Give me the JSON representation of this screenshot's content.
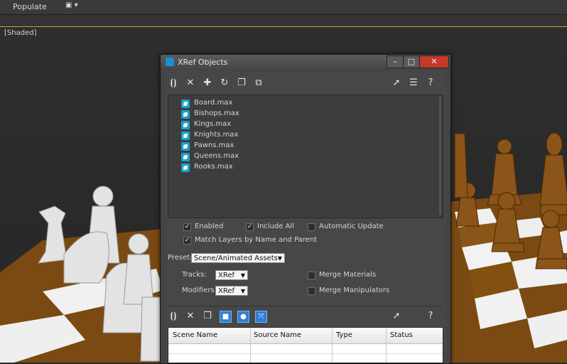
{
  "ribbon": {
    "populate_label": "Populate",
    "dropdown_glyph": "▣ ▾"
  },
  "viewport": {
    "label": "[Shaded]"
  },
  "dialog": {
    "title": "XRef Objects",
    "title_controls": {
      "minimize": "–",
      "maximize": "□",
      "close": "✕"
    },
    "files": [
      "Board.max",
      "Bishops.max",
      "Kings.max",
      "Knights.max",
      "Pawns.max",
      "Queens.max",
      "Rooks.max"
    ],
    "options": {
      "enabled": "Enabled",
      "include_all": "Include All",
      "automatic_update": "Automatic Update",
      "match_layers": "Match Layers by Name and Parent",
      "merge_materials": "Merge Materials",
      "merge_manipulators": "Merge Manipulators"
    },
    "preset": {
      "label": "Preset:",
      "value": "Scene/Animated Assets"
    },
    "tracks": {
      "label": "Tracks:",
      "value": "XRef"
    },
    "modifiers": {
      "label": "Modifiers:",
      "value": "XRef"
    },
    "table": {
      "columns": [
        "Scene Name",
        "Source Name",
        "Type",
        "Status"
      ]
    }
  },
  "icons": {
    "toolbar_top": [
      "bracket-select-icon",
      "delete-icon",
      "add-icon",
      "refresh-icon",
      "copy-icon",
      "merge-icon",
      "pointer-icon",
      "list-icon",
      "help-icon"
    ],
    "toolbar_bottom": [
      "bracket-select-icon",
      "delete-icon",
      "copy-icon",
      "object-icon",
      "sphere-icon",
      "transform-icon",
      "pointer-icon",
      "help-icon"
    ]
  },
  "colors": {
    "accent_blue": "#2f7fd8",
    "file_icon": "#1ca3c9",
    "close_button": "#c5392a",
    "board_brown": "#7a4a12"
  }
}
